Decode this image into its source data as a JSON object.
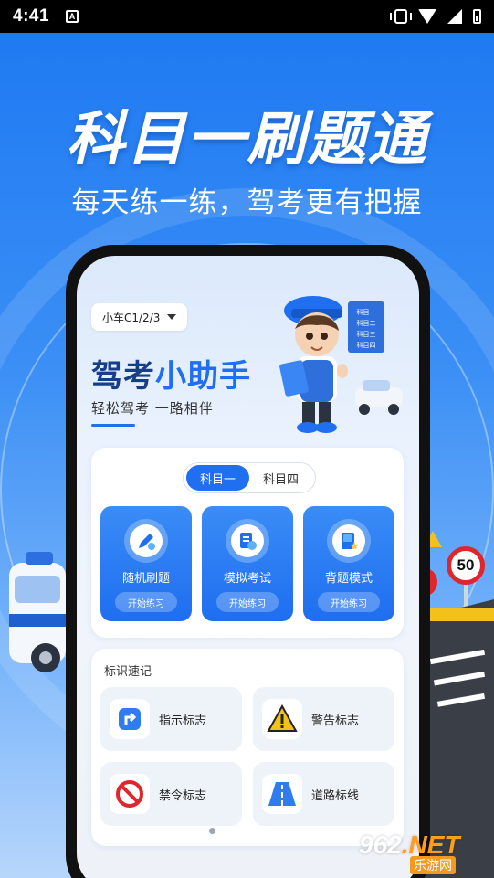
{
  "status_bar": {
    "time": "4:41",
    "notification_icon_letter": "A",
    "icons": [
      "vibrate-icon",
      "wifi-icon",
      "signal-icon",
      "battery-icon"
    ]
  },
  "banner": {
    "headline": "科目一刷题通",
    "subline": "每天练一练，驾考更有把握"
  },
  "phone": {
    "license_selector": "小车C1/2/3",
    "brand_part1": "驾考",
    "brand_part2": "小助手",
    "brand_sub": "轻松驾考 一路相伴",
    "mascot_board": [
      "科目一",
      "科目二",
      "科目三",
      "科目四"
    ]
  },
  "subject_tabs": [
    {
      "label": "科目一",
      "active": true
    },
    {
      "label": "科目四",
      "active": false
    }
  ],
  "practice_modes": [
    {
      "label": "随机刷题",
      "button": "开始练习",
      "icon": "pencil-icon"
    },
    {
      "label": "模拟考试",
      "button": "开始练习",
      "icon": "exam-clock-icon"
    },
    {
      "label": "背题模式",
      "button": "开始练习",
      "icon": "book-star-icon"
    }
  ],
  "signs_section": {
    "title": "标识速记",
    "items": [
      {
        "label": "指示标志",
        "icon": "direction-sign-icon"
      },
      {
        "label": "警告标志",
        "icon": "warning-sign-icon"
      },
      {
        "label": "禁令标志",
        "icon": "prohibition-sign-icon"
      },
      {
        "label": "道路标线",
        "icon": "road-marking-icon"
      }
    ]
  },
  "scene": {
    "speed_limit": "50"
  },
  "watermark": {
    "number": "962",
    "suffix": ".NET",
    "site": "乐游网"
  },
  "colors": {
    "primary": "#1f6ff0",
    "banner_bg": "#1f7af2",
    "warning": "#f3c11b",
    "prohibition": "#e0262d"
  }
}
